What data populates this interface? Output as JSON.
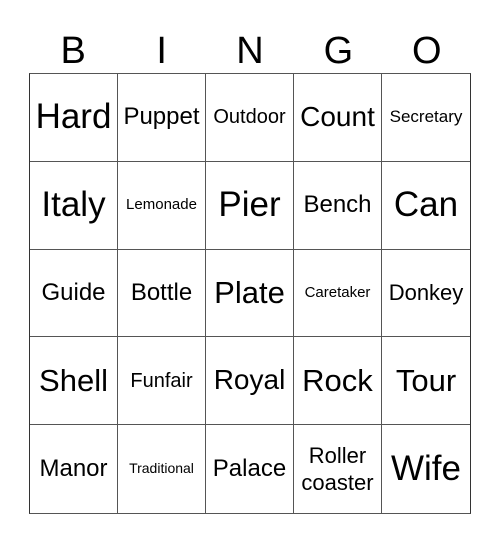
{
  "header": {
    "letters": [
      "B",
      "I",
      "N",
      "G",
      "O"
    ]
  },
  "grid": {
    "rows": [
      [
        "Hard",
        "Puppet",
        "Outdoor",
        "Count",
        "Secretary"
      ],
      [
        "Italy",
        "Lemonade",
        "Pier",
        "Bench",
        "Can"
      ],
      [
        "Guide",
        "Bottle",
        "Plate",
        "Caretaker",
        "Donkey"
      ],
      [
        "Shell",
        "Funfair",
        "Royal",
        "Rock",
        "Tour"
      ],
      [
        "Manor",
        "Traditional",
        "Palace",
        "Roller coaster",
        "Wife"
      ]
    ]
  }
}
